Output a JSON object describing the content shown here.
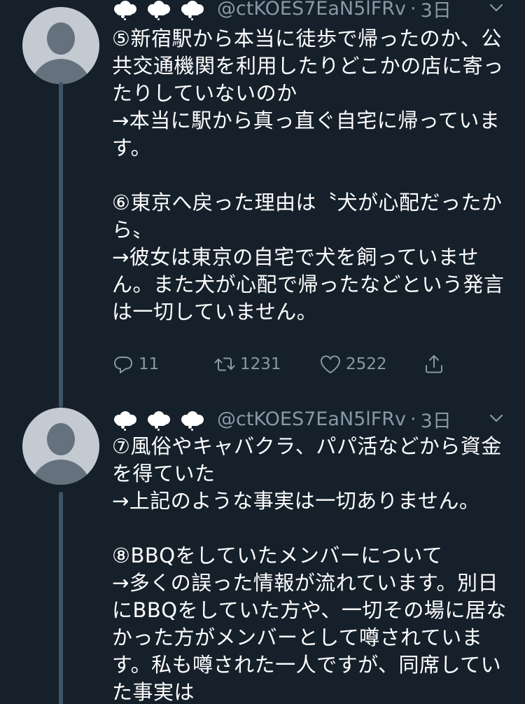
{
  "tweets": [
    {
      "handle": "@ctKOES7EaN5lFRv",
      "separator": "·",
      "time": "3日",
      "text": "⑤新宿駅から本当に徒歩で帰ったのか、公共交通機関を利用したりどこかの店に寄ったりしていないのか\n→本当に駅から真っ直ぐ自宅に帰っています。\n\n⑥東京へ戻った理由は〝犬が心配だったから〟\n→彼女は東京の自宅で犬を飼っていません。また犬が心配で帰ったなどという発言は一切していません。",
      "replies": "11",
      "retweets": "1231",
      "likes": "2522",
      "icons": [
        "cloud-emoji",
        "cloud-emoji",
        "cloud-emoji"
      ]
    },
    {
      "handle": "@ctKOES7EaN5lFRv",
      "separator": "·",
      "time": "3日",
      "text": "⑦風俗やキャバクラ、パパ活などから資金を得ていた\n→上記のような事実は一切ありません。\n\n⑧BBQをしていたメンバーについて\n→多くの誤った情報が流れています。別日にBBQをしていた方や、一切その場に居なかった方がメンバーとして噂されています。私も噂された一人ですが、同席していた事実は",
      "icons": [
        "cloud-emoji",
        "cloud-emoji",
        "cloud-emoji"
      ]
    }
  ],
  "colors": {
    "background": "#15202b",
    "text": "#ffffff",
    "secondary": "#8899a6",
    "thread_line": "#3d5466",
    "avatar_bg": "#c4cad1"
  }
}
